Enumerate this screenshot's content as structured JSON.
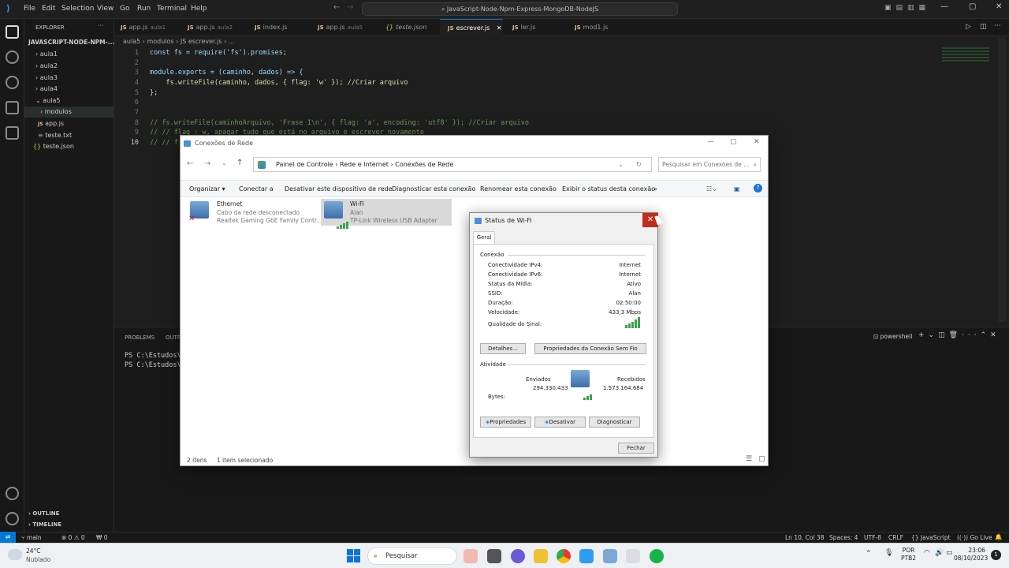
{
  "vscode": {
    "menu": [
      "File",
      "Edit",
      "Selection",
      "View",
      "Go",
      "Run",
      "Terminal",
      "Help"
    ],
    "command_center": "JavaScript-Node-Npm-Express-MongoDB-NodeJS",
    "explorer_header": "EXPLORER",
    "project": "JAVASCRIPT-NODE-NPM-...",
    "tree": [
      {
        "label": "aula1"
      },
      {
        "label": "aula2"
      },
      {
        "label": "aula3"
      },
      {
        "label": "aula4"
      },
      {
        "label": "aula5"
      },
      {
        "label": "modulos"
      },
      {
        "label": "app.js"
      },
      {
        "label": "teste.txt"
      },
      {
        "label": "teste.json"
      }
    ],
    "outline": "OUTLINE",
    "timeline": "TIMELINE",
    "tabs": [
      {
        "label": "app.js",
        "desc": "aula1"
      },
      {
        "label": "app.js",
        "desc": "aula2"
      },
      {
        "label": "index.js",
        "desc": ""
      },
      {
        "label": "app.js",
        "desc": "aula5"
      },
      {
        "label": "teste.json",
        "desc": ""
      },
      {
        "label": "escrever.js",
        "desc": ""
      },
      {
        "label": "ler.js",
        "desc": ""
      },
      {
        "label": "mod1.js",
        "desc": ""
      }
    ],
    "breadcrumb": "aula5 › modulos › JS escrever.js › ...",
    "code": {
      "l1": "const fs = require('fs').promises;",
      "l3": "module.exports = (caminho, dados) => {",
      "l4": "    fs.writeFile(caminho, dados, { flag: 'w' }); //Criar arquivo",
      "l5": "};",
      "l8": "// fs.writeFile(caminhoArquivo, 'Frase 1\\n', { flag: 'a', encoding: 'utf8' }); //Criar arquivo",
      "l9": "// // flag : w, apagar tudo que está no arquivo e escrever novamente",
      "l10": "// // f"
    },
    "line_numbers": [
      "1",
      "2",
      "3",
      "4",
      "5",
      "6",
      "7",
      "8",
      "9",
      "10"
    ],
    "panel": {
      "tab1": "PROBLEMS",
      "tab2": "OUTP",
      "t1": "PS C:\\Estudos\\C",
      "t2": "PS C:\\Estudos\\C",
      "shell": "powershell"
    },
    "status": {
      "branch": "main",
      "errors": "⊗ 0 ⚠ 0",
      "ports": "₩ 0",
      "pos": "Ln 10, Col 38",
      "spaces": "Spaces: 4",
      "enc": "UTF-8",
      "eol": "CRLF",
      "lang": "{} JavaScript",
      "golive": "Go Live"
    }
  },
  "explorer": {
    "title": "Conexões de Rede",
    "path": [
      "Painel de Controle",
      "Rede e Internet",
      "Conexões de Rede"
    ],
    "search_placeholder": "Pesquisar em Conexões de ...",
    "commands": [
      "Organizar ▾",
      "Conectar a",
      "Desativar este dispositivo de rede",
      "Diagnosticar esta conexão",
      "Renomear esta conexão",
      "Exibir o status desta conexão",
      "»"
    ],
    "items": [
      {
        "name": "Ethernet",
        "status": "Cabo da rede desconectado",
        "device": "Realtek Gaming GbE Family Contr..."
      },
      {
        "name": "Wi-Fi",
        "status": "Alan",
        "device": "TP-Link Wireless USB Adapter"
      }
    ],
    "footer_count": "2 itens",
    "footer_sel": "1 item selecionado"
  },
  "wifi_dialog": {
    "title": "Status de Wi-Fi",
    "tab": "Geral",
    "section1": "Conexão",
    "rows": [
      {
        "k": "Conectividade IPv4:",
        "v": "Internet"
      },
      {
        "k": "Conectividade IPv6:",
        "v": "Internet"
      },
      {
        "k": "Status da Mídia:",
        "v": "Ativo"
      },
      {
        "k": "SSID:",
        "v": "Alan"
      },
      {
        "k": "Duração:",
        "v": "02:50:00"
      },
      {
        "k": "Velocidade:",
        "v": "433,3 Mbps"
      },
      {
        "k": "Qualidade do Sinal:",
        "v": ""
      }
    ],
    "details_btn": "Detalhes...",
    "wireless_props_btn": "Propriedades da Conexão Sem Fio",
    "section2": "Atividade",
    "sent_label": "Enviados",
    "recv_label": "Recebidos",
    "sent": "294.330.433",
    "recv": "1.573.164.684",
    "bytes_label": "Bytes:",
    "props_btn": "Propriedades",
    "disable_btn": "Desativar",
    "diag_btn": "Diagnosticar",
    "close_btn": "Fechar"
  },
  "taskbar": {
    "temp": "24°C",
    "weather": "Nublado",
    "search": "Pesquisar",
    "lang1": "POR",
    "lang2": "PTB2",
    "time": "23:06",
    "date": "08/10/2023"
  }
}
